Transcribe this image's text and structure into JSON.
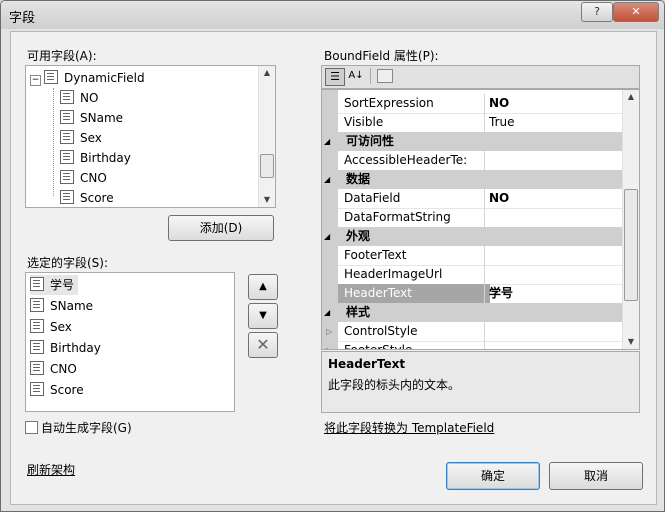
{
  "window": {
    "title": "字段",
    "help": "?",
    "close": "✕"
  },
  "available": {
    "label": "可用字段(A):",
    "root": "DynamicField",
    "items": [
      "NO",
      "SName",
      "Sex",
      "Birthday",
      "CNO",
      "Score"
    ]
  },
  "add_button": "添加(D)",
  "selected": {
    "label": "选定的字段(S):",
    "items": [
      "学号",
      "SName",
      "Sex",
      "Birthday",
      "CNO",
      "Score"
    ]
  },
  "auto_generate": {
    "label": "自动生成字段(G)",
    "checked": false
  },
  "refresh_schema": "刷新架构",
  "properties": {
    "label": "BoundField 属性(P):",
    "rows": [
      {
        "kind": "prop",
        "name": "SortExpression",
        "value": "NO",
        "bold": true
      },
      {
        "kind": "prop",
        "name": "Visible",
        "value": "True",
        "bold": false
      },
      {
        "kind": "cat",
        "name": "可访问性"
      },
      {
        "kind": "prop",
        "name": "AccessibleHeaderTe:",
        "value": "",
        "bold": false
      },
      {
        "kind": "cat",
        "name": "数据"
      },
      {
        "kind": "prop",
        "name": "DataField",
        "value": "NO",
        "bold": true
      },
      {
        "kind": "prop",
        "name": "DataFormatString",
        "value": "",
        "bold": false
      },
      {
        "kind": "cat",
        "name": "外观"
      },
      {
        "kind": "prop",
        "name": "FooterText",
        "value": "",
        "bold": false
      },
      {
        "kind": "prop",
        "name": "HeaderImageUrl",
        "value": "",
        "bold": false
      },
      {
        "kind": "prop",
        "name": "HeaderText",
        "value": "学号",
        "bold": true,
        "selected": true
      },
      {
        "kind": "cat",
        "name": "样式"
      },
      {
        "kind": "prop",
        "name": "ControlStyle",
        "value": "",
        "bold": false,
        "expandable": true
      },
      {
        "kind": "prop",
        "name": "FooterStyle",
        "value": "",
        "bold": false,
        "expandable": true
      }
    ],
    "description_title": "HeaderText",
    "description_text": "此字段的标头内的文本。"
  },
  "convert_link": "将此字段转换为 TemplateField",
  "ok_button": "确定",
  "cancel_button": "取消",
  "colors": {
    "selected_row": "#a6a6a6",
    "category_bg": "#cfcfcf"
  },
  "icons": [
    "categorized-icon",
    "alphabetical-icon",
    "property-pages-icon",
    "move-up-icon",
    "move-down-icon",
    "delete-icon",
    "field-icon"
  ]
}
